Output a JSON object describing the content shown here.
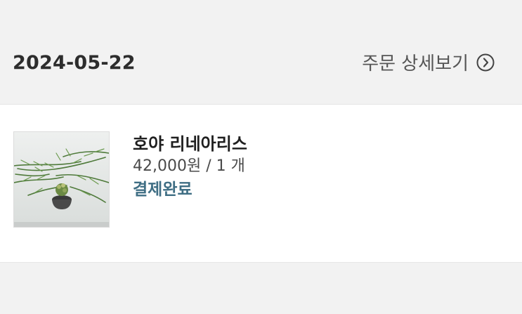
{
  "order": {
    "date": "2024-05-22",
    "detail_link_label": "주문 상세보기",
    "detail_icon": "chevron-right-circle-icon"
  },
  "item": {
    "name": "호야 리네아리스",
    "price_qty": "42,000원 / 1 개",
    "status": "결제완료",
    "thumbnail_alt": "hoya-linearis-plant-photo"
  },
  "colors": {
    "status": "#3f6e84",
    "background": "#f2f2f2",
    "card": "#ffffff"
  }
}
